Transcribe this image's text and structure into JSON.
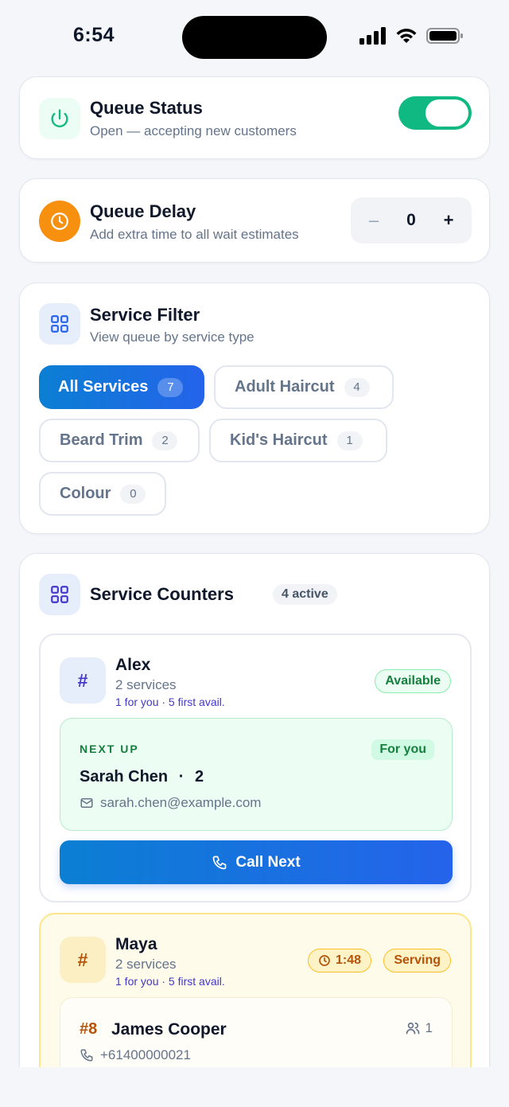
{
  "status_bar": {
    "time": "6:54"
  },
  "queue_status": {
    "title": "Queue Status",
    "subtitle": "Open — accepting new customers",
    "toggle_on": true,
    "icon": "power-icon",
    "accent": "#10b981"
  },
  "queue_delay": {
    "title": "Queue Delay",
    "subtitle": "Add extra time to all wait estimates",
    "value": "0",
    "minus_label": "–",
    "plus_label": "+",
    "icon": "clock-icon",
    "accent": "#f59e0b"
  },
  "service_filter": {
    "title": "Service Filter",
    "subtitle": "View queue by service type",
    "chips": [
      {
        "label": "All Services",
        "count": "7",
        "active": true
      },
      {
        "label": "Adult Haircut",
        "count": "4",
        "active": false
      },
      {
        "label": "Beard Trim",
        "count": "2",
        "active": false
      },
      {
        "label": "Kid's Haircut",
        "count": "1",
        "active": false
      },
      {
        "label": "Colour",
        "count": "0",
        "active": false
      }
    ]
  },
  "service_counters": {
    "title": "Service Counters",
    "active_count": "4 active",
    "counters": [
      {
        "hash": "#",
        "name": "Alex",
        "services": "2 services",
        "meta": "1 for you · 5 first avail.",
        "status": "Available",
        "next_up": {
          "label": "NEXT UP",
          "for_you": "For you",
          "name": "Sarah Chen",
          "party": "2",
          "email": "sarah.chen@example.com"
        },
        "call_button": "Call Next"
      },
      {
        "hash": "#",
        "name": "Maya",
        "services": "2 services",
        "meta": "1 for you · 5 first avail.",
        "timer": "1:48",
        "status": "Serving",
        "serving": {
          "ticket": "#8",
          "name": "James Cooper",
          "party": "1",
          "phone": "+61400000021"
        }
      }
    ]
  },
  "colors": {
    "primary_gradient_start": "#0b7fd3",
    "primary_gradient_end": "#2563eb",
    "available_green": "#15803d",
    "serving_amber": "#b45309"
  }
}
